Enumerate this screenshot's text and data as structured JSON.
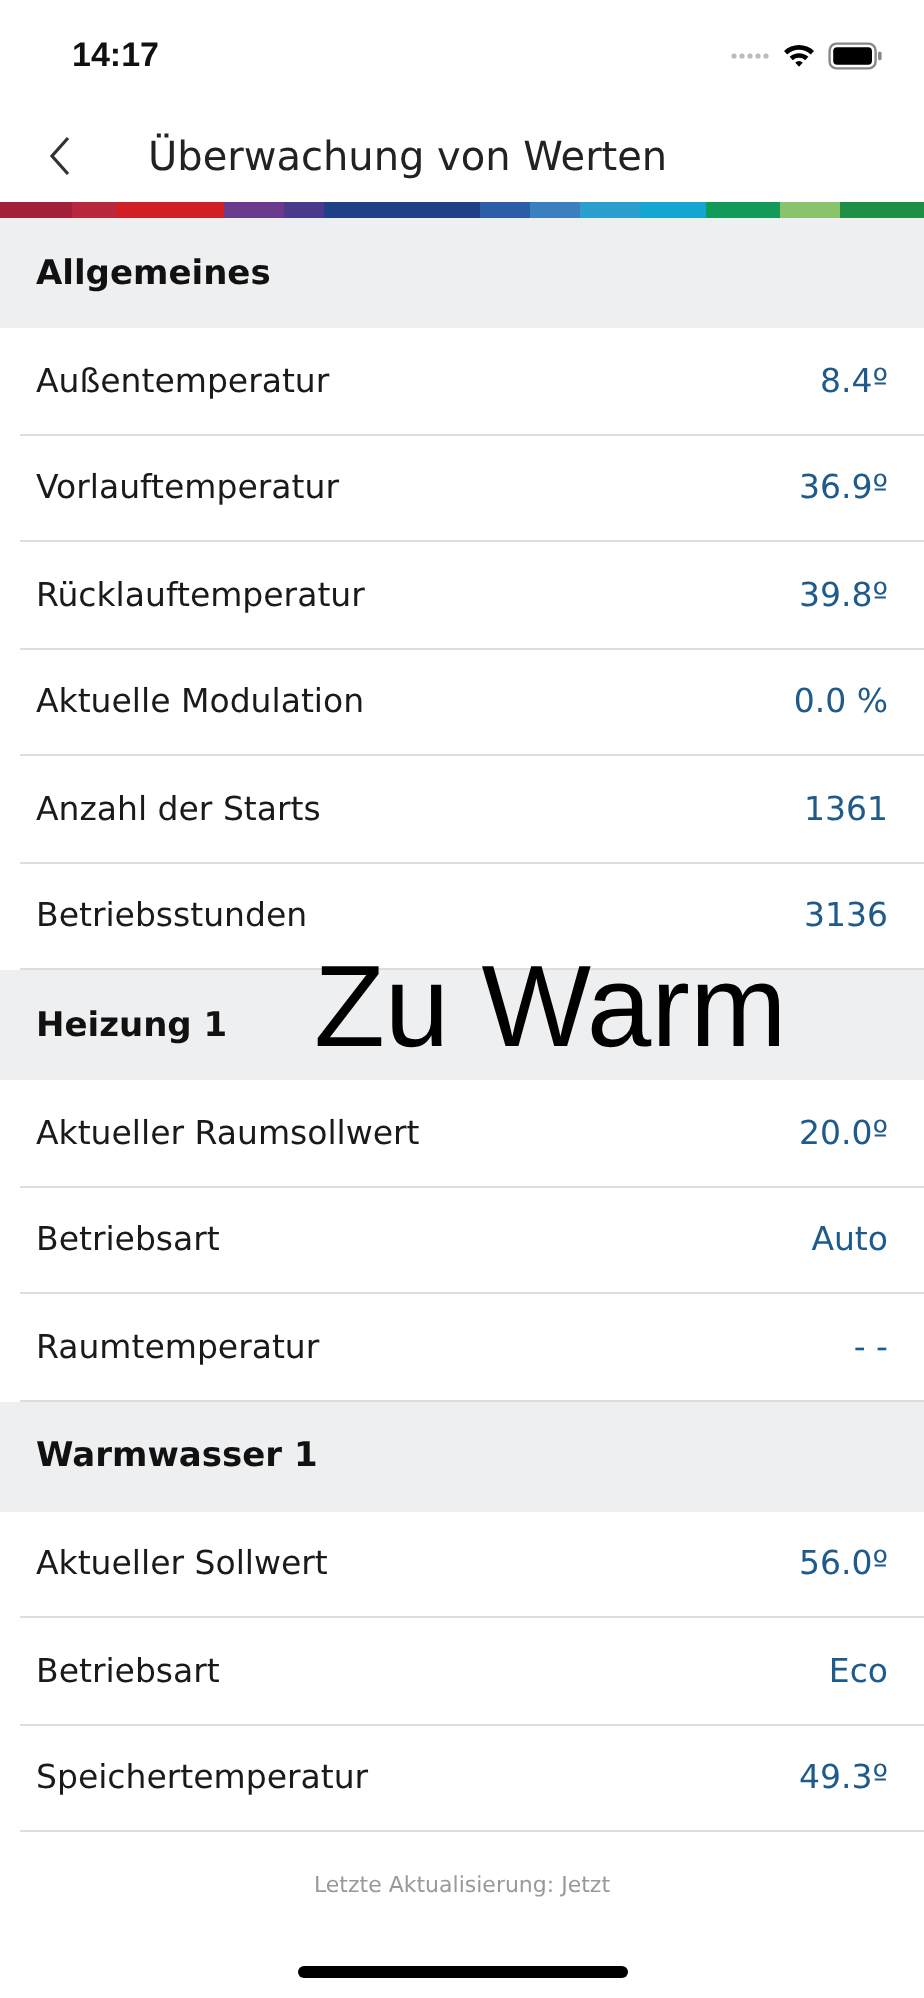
{
  "status_bar": {
    "time": "14:17"
  },
  "header": {
    "title": "Überwachung von Werten"
  },
  "sections": [
    {
      "title": "Allgemeines",
      "rows": [
        {
          "label": "Außentemperatur",
          "value": "8.4º"
        },
        {
          "label": "Vorlauftemperatur",
          "value": "36.9º"
        },
        {
          "label": "Rücklauftemperatur",
          "value": "39.8º"
        },
        {
          "label": "Aktuelle Modulation",
          "value": "0.0 %"
        },
        {
          "label": "Anzahl der Starts",
          "value": "1361"
        },
        {
          "label": "Betriebsstunden",
          "value": "3136"
        }
      ]
    },
    {
      "title": "Heizung 1",
      "rows": [
        {
          "label": "Aktueller Raumsollwert",
          "value": "20.0º"
        },
        {
          "label": "Betriebsart",
          "value": "Auto"
        },
        {
          "label": "Raumtemperatur",
          "value": "- -"
        }
      ]
    },
    {
      "title": "Warmwasser 1",
      "rows": [
        {
          "label": "Aktueller Sollwert",
          "value": "56.0º"
        },
        {
          "label": "Betriebsart",
          "value": "Eco"
        },
        {
          "label": "Speichertemperatur",
          "value": "49.3º"
        }
      ]
    }
  ],
  "footer": "Letzte Aktualisierung: Jetzt",
  "overlay_text": "Zu Warm"
}
